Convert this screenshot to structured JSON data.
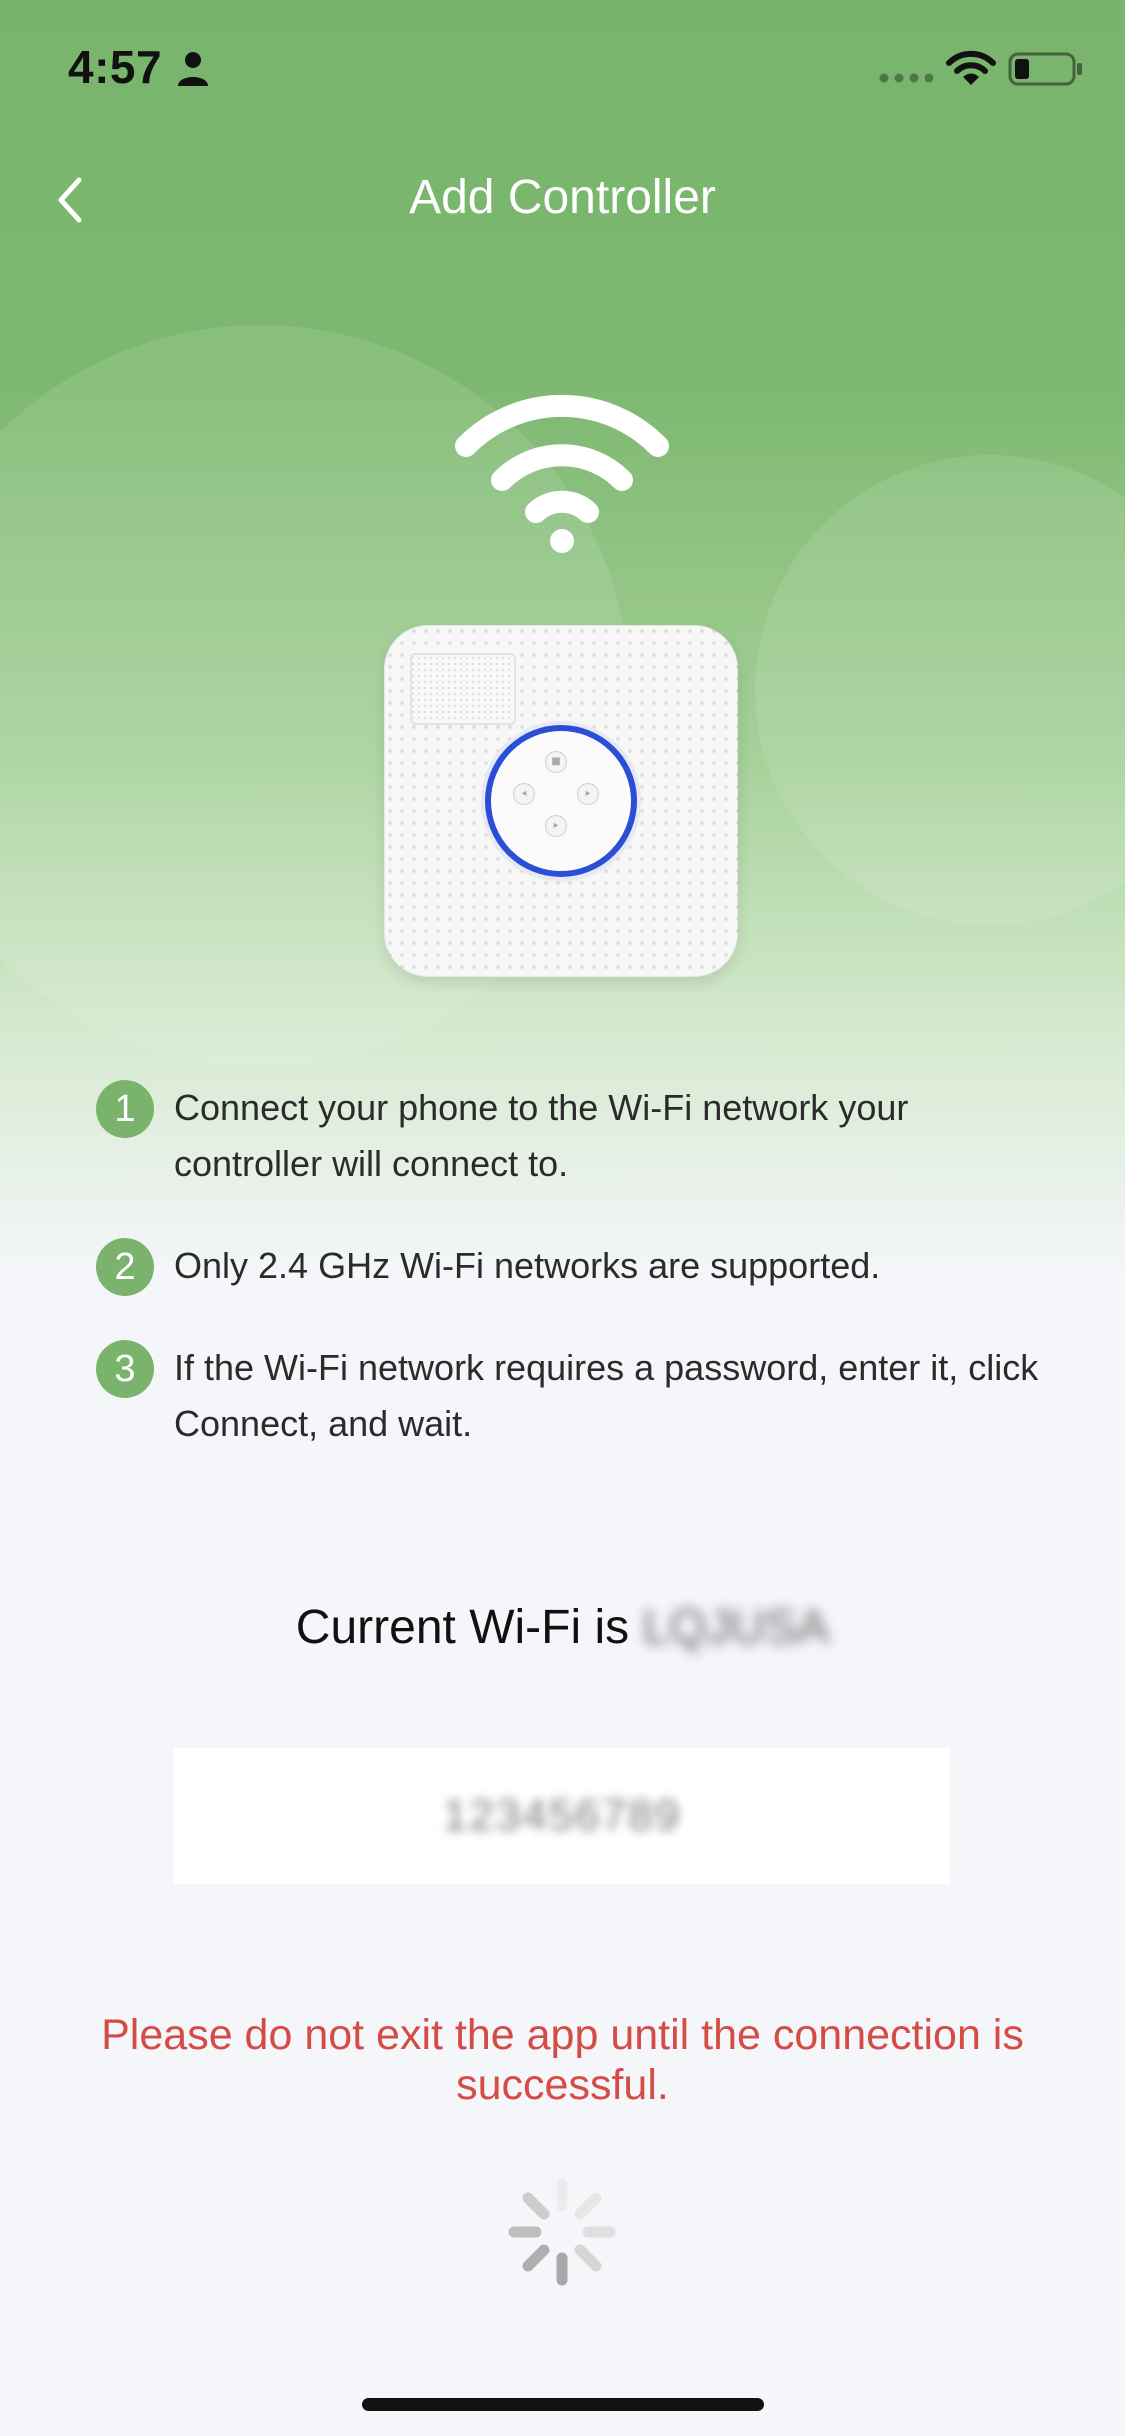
{
  "status_bar": {
    "time": "4:57",
    "icons": [
      "person-icon",
      "cellular-signal-icon",
      "wifi-icon",
      "battery-icon"
    ]
  },
  "header": {
    "title": "Add Controller",
    "back_icon": "chevron-left-icon"
  },
  "illustration": {
    "icons": [
      "wifi-icon",
      "controller-device-image"
    ],
    "dial_accent": "#2a4fd6"
  },
  "steps": [
    {
      "number": "1",
      "text": "Connect your phone to the Wi-Fi network your controller will connect to."
    },
    {
      "number": "2",
      "text": "Only 2.4 GHz Wi-Fi networks are supported."
    },
    {
      "number": "3",
      "text": "If the Wi-Fi network requires a password, enter it, click Connect, and wait."
    }
  ],
  "wifi": {
    "prefix": "Current Wi-Fi is",
    "ssid": "LQJUSA"
  },
  "password": {
    "value": "123456789"
  },
  "warning": "Please do not exit the app until the connection is successful.",
  "loading_icon": "spinner-icon",
  "colors": {
    "header_green": "#7db870",
    "step_badge": "#7ab46c",
    "warning_red": "#d44c45",
    "background": "#f5f6fa"
  }
}
